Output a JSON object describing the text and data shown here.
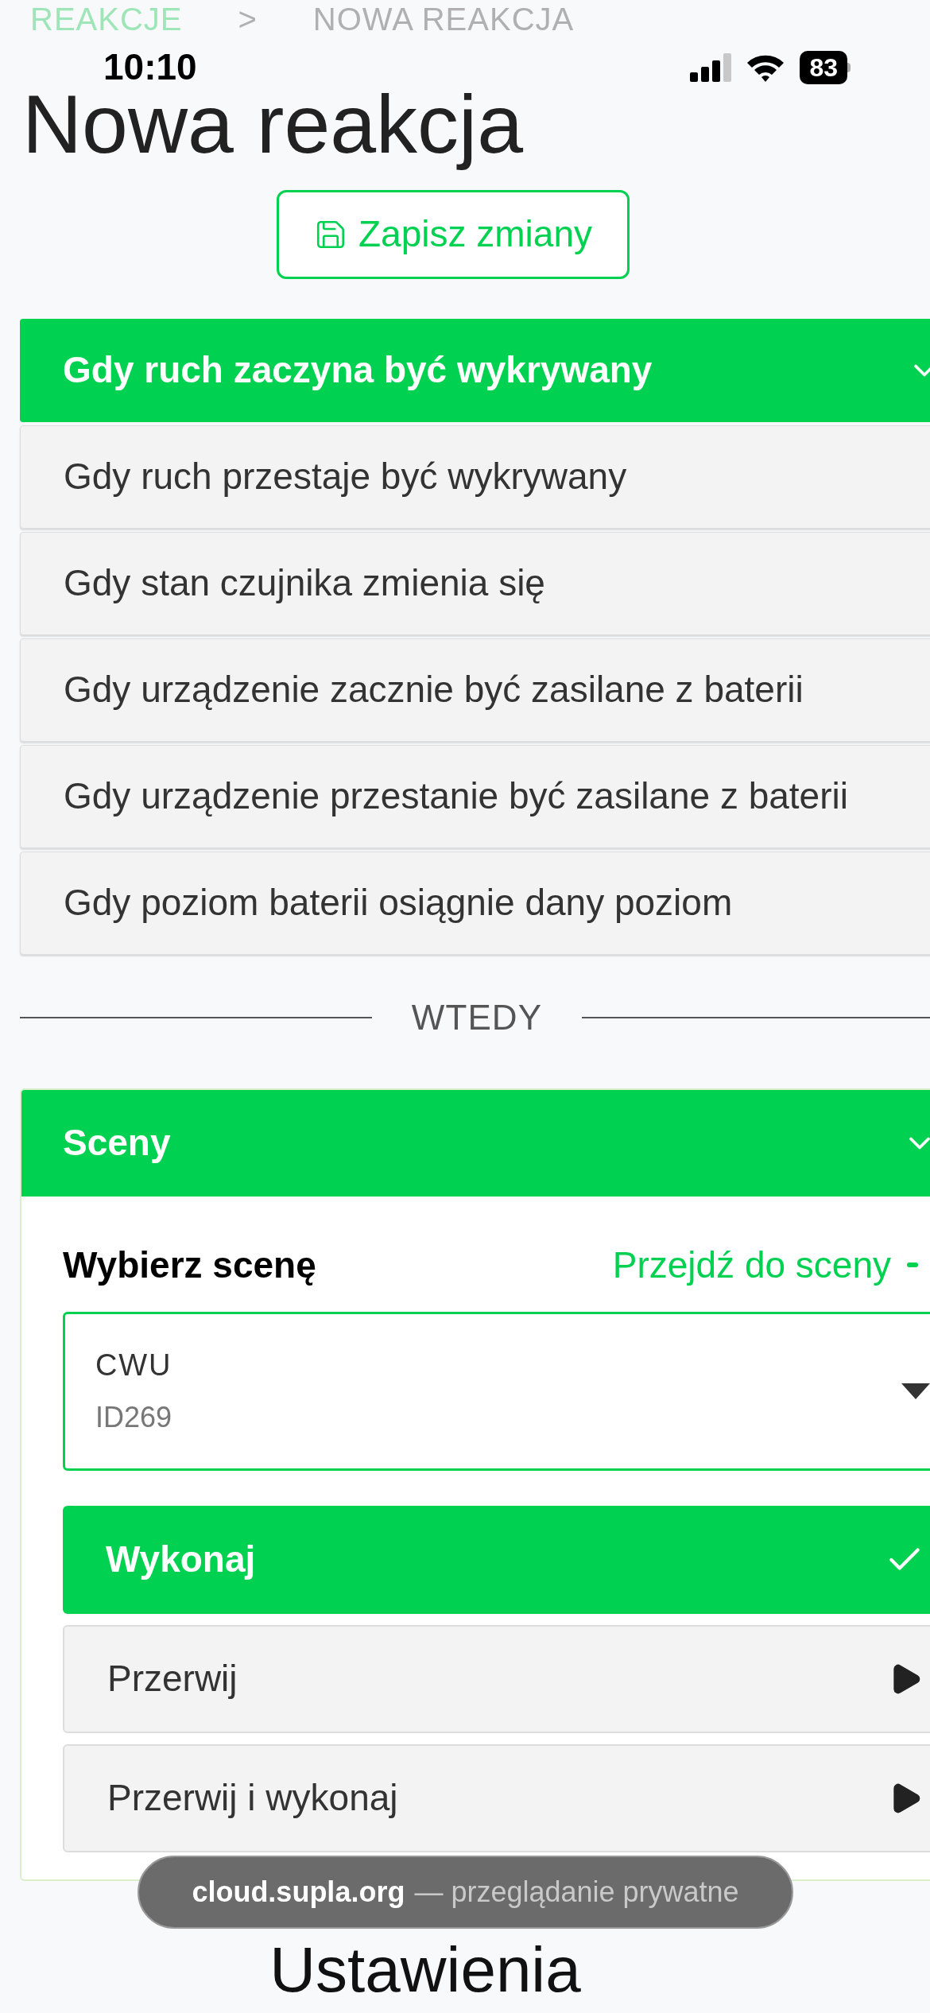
{
  "status_bar": {
    "time": "10:10",
    "battery": "83"
  },
  "breadcrumb": {
    "parent": "REAKCJE",
    "separator": ">",
    "current": "NOWA REAKCJA"
  },
  "title": "Nowa reakcja",
  "save_button": "Zapisz zmiany",
  "triggers": [
    {
      "label": "Gdy ruch zaczyna być wykrywany",
      "selected": true
    },
    {
      "label": "Gdy ruch przestaje być wykrywany",
      "selected": false
    },
    {
      "label": "Gdy stan czujnika zmienia się",
      "selected": false
    },
    {
      "label": "Gdy urządzenie zacznie być zasilane z baterii",
      "selected": false
    },
    {
      "label": "Gdy urządzenie przestanie być zasilane z baterii",
      "selected": false
    },
    {
      "label": "Gdy poziom baterii osiągnie dany poziom",
      "selected": false
    }
  ],
  "divider": "WTEDY",
  "action_card": {
    "title": "Sceny",
    "expanded": true,
    "field_label": "Wybierz scenę",
    "link": "Przejdź do sceny",
    "select": {
      "value": "CWU",
      "caption": "ID269"
    },
    "actions": [
      {
        "label": "Wykonaj",
        "selected": true
      },
      {
        "label": "Przerwij",
        "selected": false
      },
      {
        "label": "Przerwij i wykonaj",
        "selected": false
      }
    ]
  },
  "browser_pill": {
    "domain": "cloud.supla.org",
    "mode": "— przeglądanie prywatne"
  },
  "next_section": "Ustawienia"
}
